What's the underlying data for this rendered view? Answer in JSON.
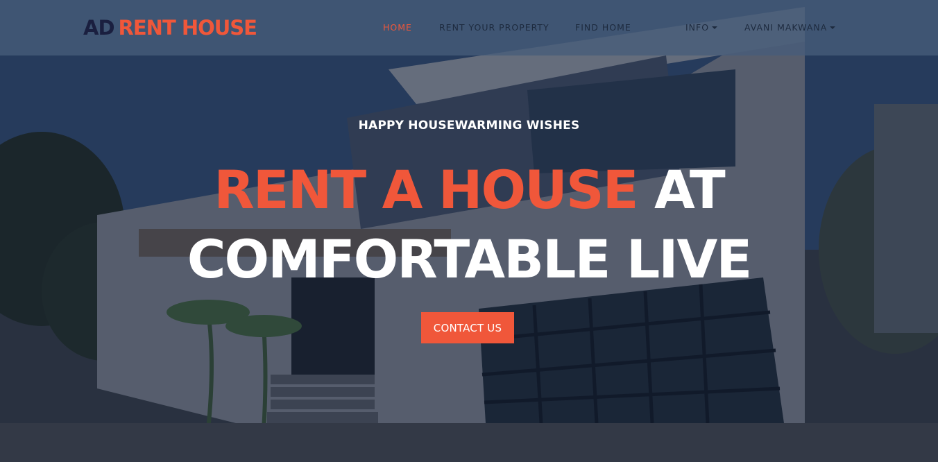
{
  "brand": {
    "part1": "AD",
    "part2": "RENT HOUSE"
  },
  "nav": {
    "home": "HOME",
    "rent_property": "RENT YOUR PROPERTY",
    "find_home": "FIND HOME",
    "info": "INFO",
    "user": "AVANI MAKWANA"
  },
  "hero": {
    "kicker": "HAPPY HOUSEWARMING WISHES",
    "headline_accent": "RENT A HOUSE",
    "headline_rest": "AT",
    "headline_line2": "COMFORTABLE LIVE",
    "cta": "CONTACT US"
  },
  "colors": {
    "accent": "#f0573a",
    "brand_dark": "#1a1f3f",
    "navbar": "#465c7a",
    "nav_text": "#1d2a3e"
  },
  "icons": {
    "dropdown": "caret-down-icon"
  }
}
